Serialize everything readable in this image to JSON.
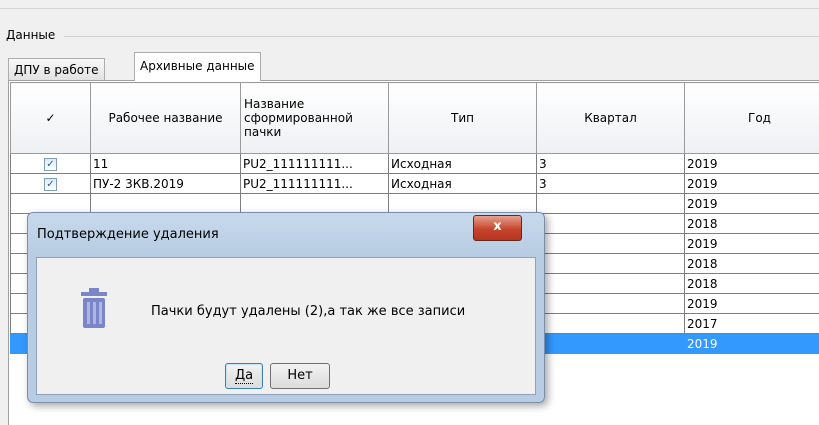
{
  "group": {
    "label": "Данные"
  },
  "tabs": [
    {
      "label": "ДПУ в работе"
    },
    {
      "label": "Архивные данные"
    }
  ],
  "grid": {
    "headers": {
      "check": "✓",
      "work_name": "Рабочее название",
      "pack_name": "Название сформированной пачки",
      "type": "Тип",
      "quarter": "Квартал",
      "year": "Год"
    },
    "rows": [
      {
        "check": "✓",
        "work_name": "11",
        "pack_name": "PU2_111111111...",
        "type": "Исходная",
        "quarter": "3",
        "year": "2019"
      },
      {
        "check": "✓",
        "work_name": "ПУ-2 3КВ.2019",
        "pack_name": "PU2_111111111...",
        "type": "Исходная",
        "quarter": "3",
        "year": "2019"
      },
      {
        "check": "",
        "work_name": "",
        "pack_name": "",
        "type": "",
        "quarter": "",
        "year": "2019"
      },
      {
        "check": "",
        "work_name": "",
        "pack_name": "",
        "type": "",
        "quarter": "",
        "year": "2018"
      },
      {
        "check": "",
        "work_name": "",
        "pack_name": "",
        "type": "",
        "quarter": "",
        "year": "2019"
      },
      {
        "check": "",
        "work_name": "",
        "pack_name": "",
        "type": "",
        "quarter": "",
        "year": "2018"
      },
      {
        "check": "",
        "work_name": "",
        "pack_name": "",
        "type": "",
        "quarter": "",
        "year": "2018"
      },
      {
        "check": "",
        "work_name": "",
        "pack_name": "",
        "type": "",
        "quarter": "",
        "year": "2019"
      },
      {
        "check": "",
        "work_name": "",
        "pack_name": "",
        "type": "",
        "quarter": "",
        "year": "2017"
      },
      {
        "check": "",
        "work_name": "",
        "pack_name": "",
        "type": "",
        "quarter": "",
        "year": "2019"
      }
    ],
    "selected_row": 9
  },
  "dialog": {
    "title": "Подтверждение удаления",
    "close_label": "x",
    "message": "Пачки будут удалены (2),а так же все записи",
    "icon": "trash-icon",
    "yes_label": "Да",
    "no_label": "Нет"
  },
  "colors": {
    "selection": "#3399ff",
    "icon": "#7a86c8",
    "close": "#c6452d"
  }
}
